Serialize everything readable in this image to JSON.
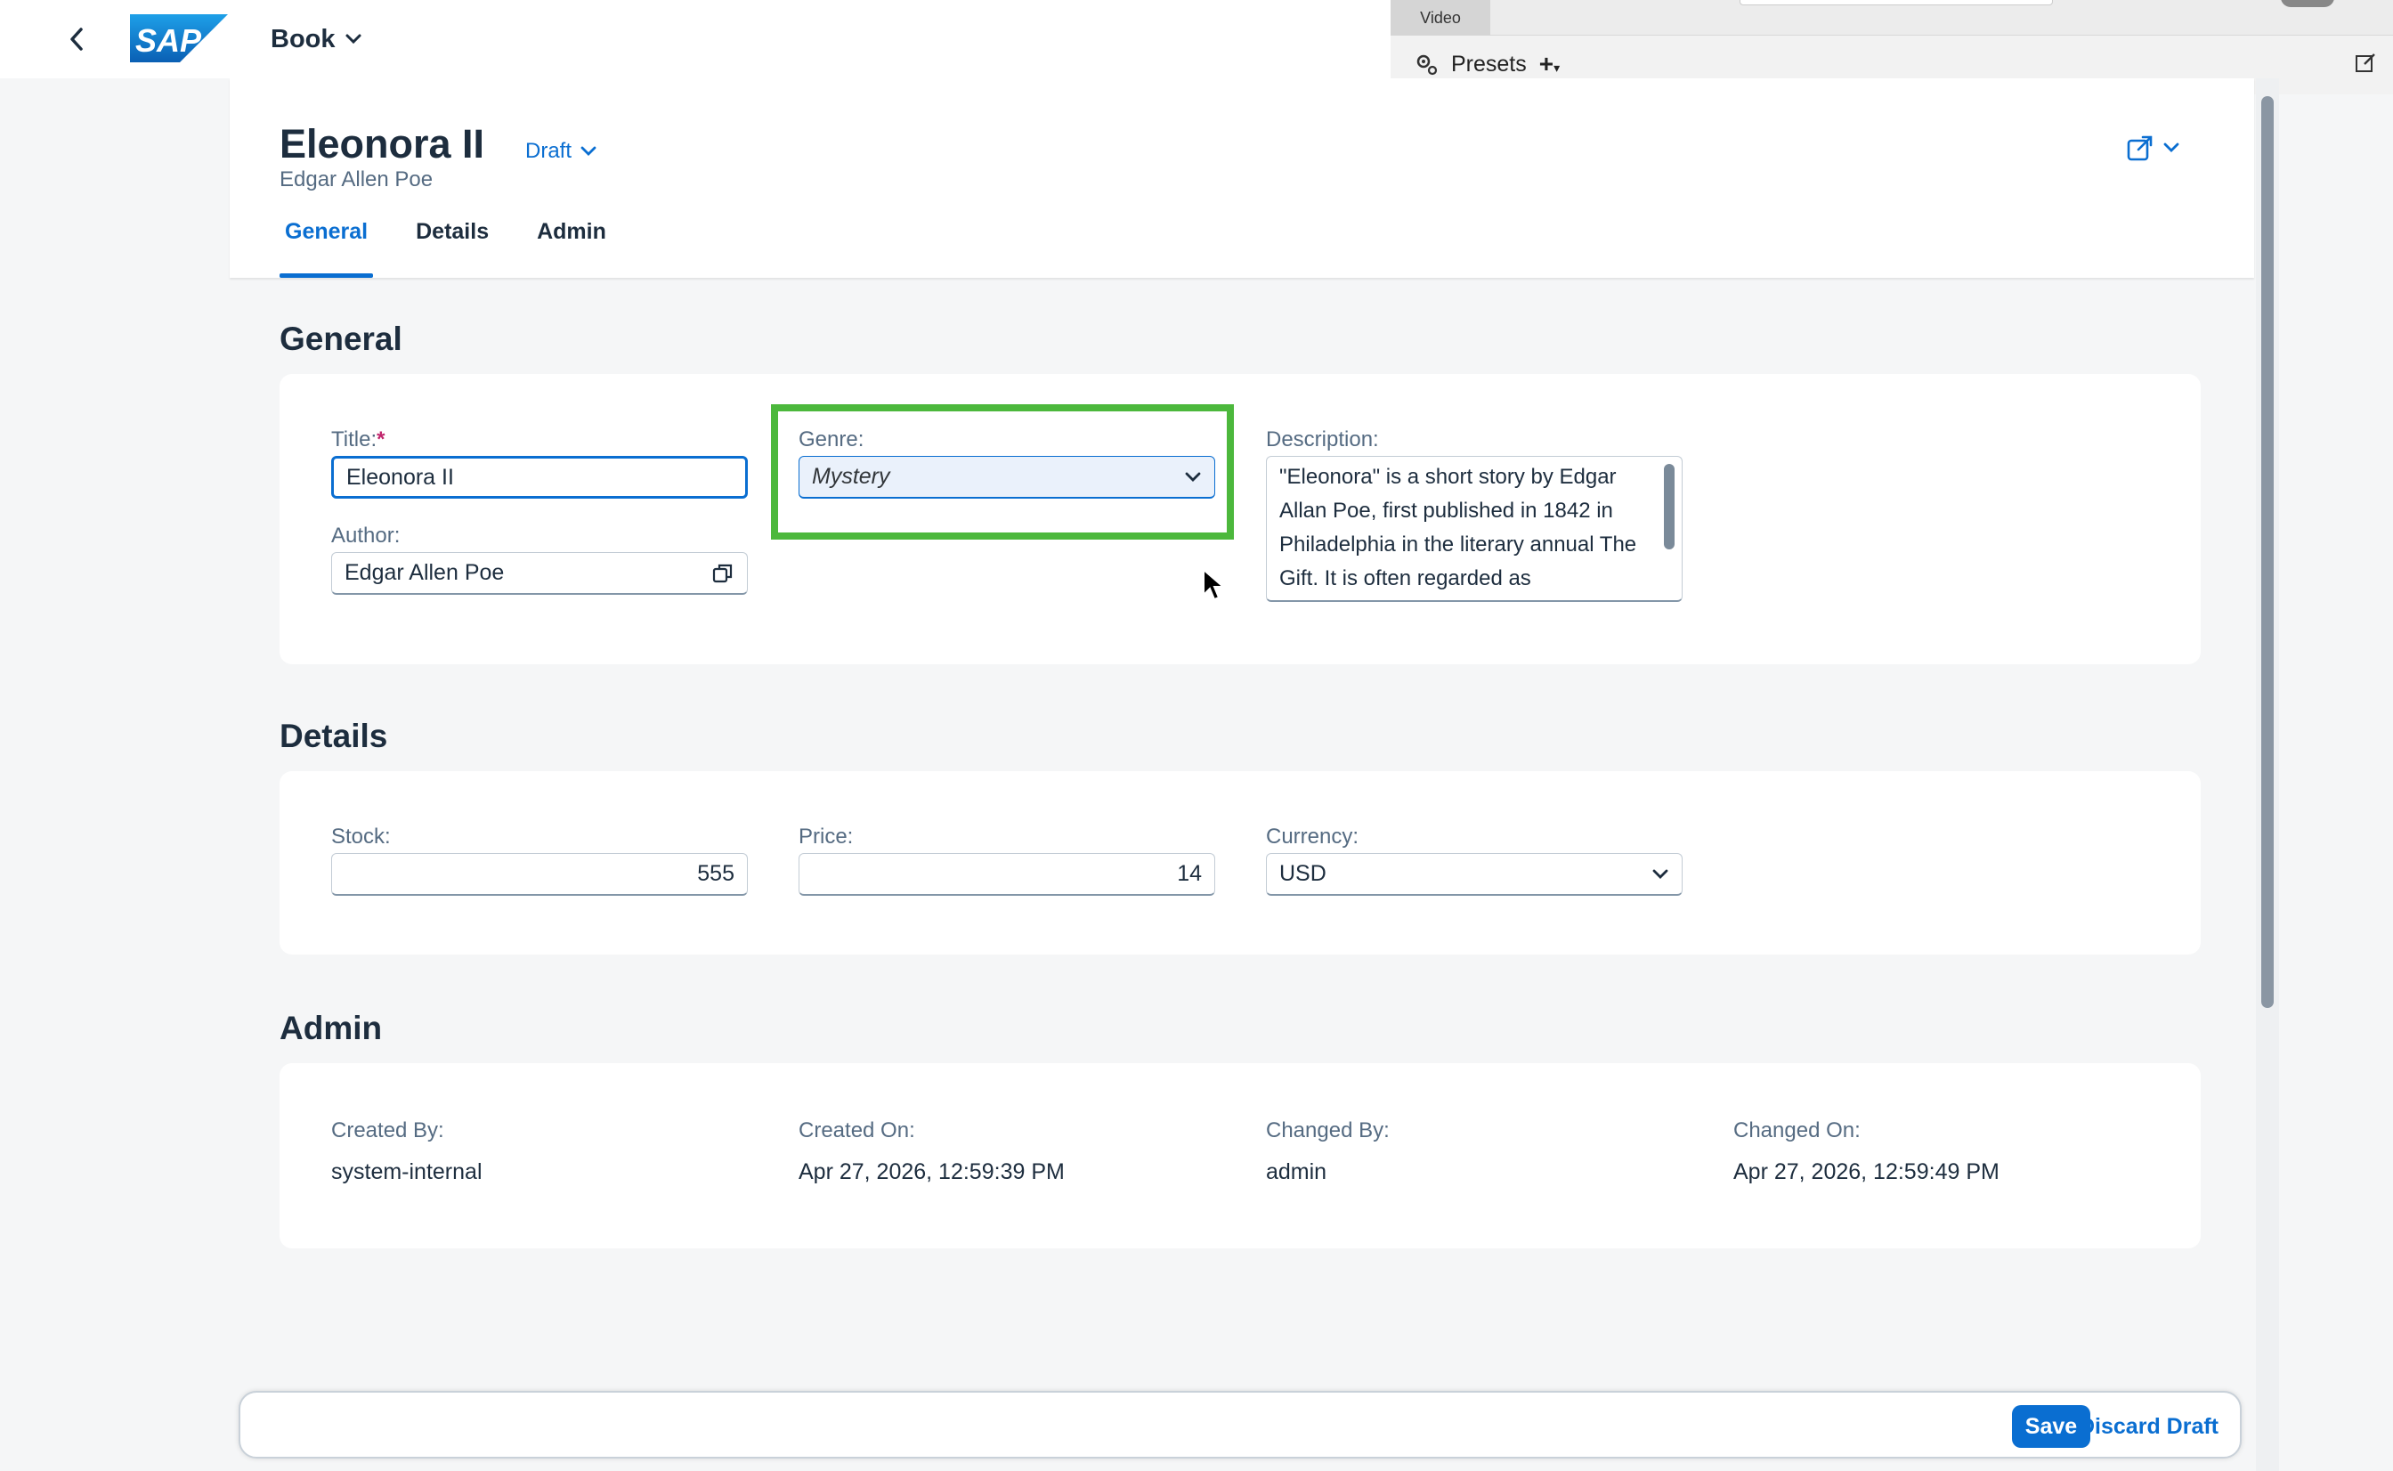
{
  "shell": {
    "app_title": "Book"
  },
  "overlay": {
    "tab_label": "Video",
    "presets_label": "Presets",
    "add_label": "+"
  },
  "header": {
    "title": "Eleonora II",
    "subtitle": "Edgar Allen Poe",
    "status": "Draft",
    "tabs": [
      {
        "label": "General"
      },
      {
        "label": "Details"
      },
      {
        "label": "Admin"
      }
    ]
  },
  "general": {
    "section_title": "General",
    "title_label": "Title:",
    "title_required": "*",
    "title_value": "Eleonora II",
    "author_label": "Author:",
    "author_value": "Edgar Allen Poe",
    "genre_label": "Genre:",
    "genre_value": "Mystery",
    "description_label": "Description:",
    "description_value": "\"Eleonora\" is a short story by Edgar Allan Poe, first published in 1842 in Philadelphia in the literary annual The Gift. It is often regarded as"
  },
  "details": {
    "section_title": "Details",
    "stock_label": "Stock:",
    "stock_value": "555",
    "price_label": "Price:",
    "price_value": "14",
    "currency_label": "Currency:",
    "currency_value": "USD"
  },
  "admin": {
    "section_title": "Admin",
    "created_by_label": "Created By:",
    "created_by_value": "system-internal",
    "created_on_label": "Created On:",
    "created_on_value": "Apr 27, 2026, 12:59:39 PM",
    "changed_by_label": "Changed By:",
    "changed_by_value": "admin",
    "changed_on_label": "Changed On:",
    "changed_on_value": "Apr 27, 2026, 12:59:49 PM"
  },
  "footer": {
    "save_label": "Save",
    "discard_label": "Discard Draft"
  },
  "colors": {
    "accent": "#0a6ed1",
    "highlight": "#4cb83c",
    "required": "#c0246c"
  }
}
